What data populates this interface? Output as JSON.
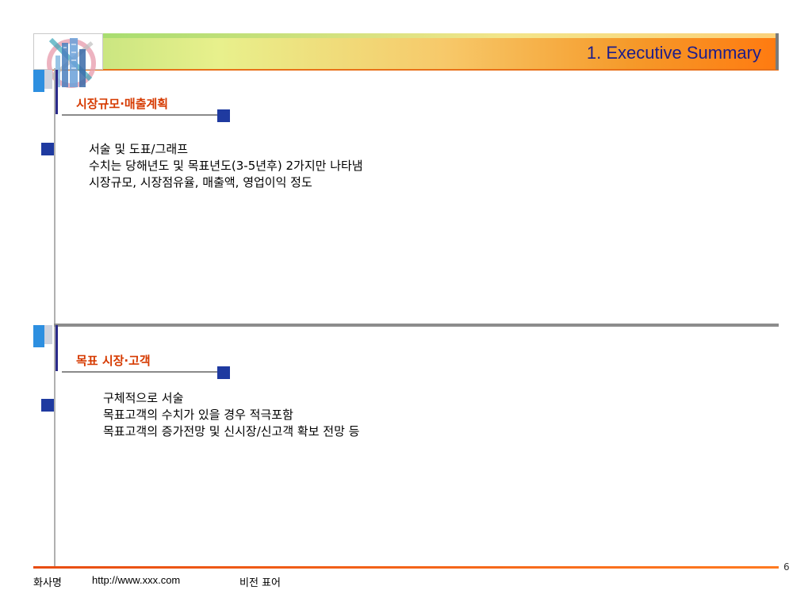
{
  "header": {
    "title": "1. Executive Summary"
  },
  "sections": [
    {
      "title": "시장규모·매출계획",
      "lines": [
        "서술 및 도표/그래프",
        "수치는 당해년도 및 목표년도(3-5년후) 2가지만 나타냄",
        "시장규모, 시장점유율, 매출액, 영업이익 정도"
      ]
    },
    {
      "title": "목표 시장·고객",
      "lines": [
        "구체적으로 서술",
        "목표고객의 수치가 있을 경우 적극포함",
        "목표고객의 증가전망 및 신시장/신고객 확보 전망 등"
      ]
    }
  ],
  "footer": {
    "company": "화사명",
    "url": "http://www.xxx.com",
    "vision": "비전 표어",
    "page_number": "6"
  },
  "colors": {
    "accent_orange": "#d63a00",
    "title_blue": "#1d1d8a",
    "square_blue": "#1f3aa0",
    "light_blue": "#2d8fe0"
  },
  "icons": {
    "logo": "building-logo-icon"
  }
}
